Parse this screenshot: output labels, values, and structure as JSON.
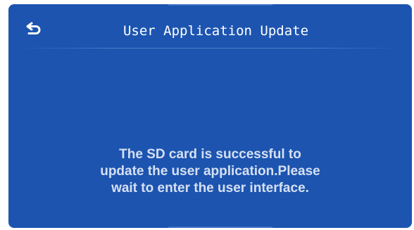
{
  "header": {
    "back_icon": "back-arrow-icon",
    "title": "User Application Update"
  },
  "message": {
    "lines": [
      "The SD card is successful to",
      "update the user application.Please",
      "wait to enter the user interface."
    ]
  },
  "colors": {
    "background": "#1c54b0",
    "title_text": "#ffffff",
    "message_text": "#d6e0f2"
  }
}
